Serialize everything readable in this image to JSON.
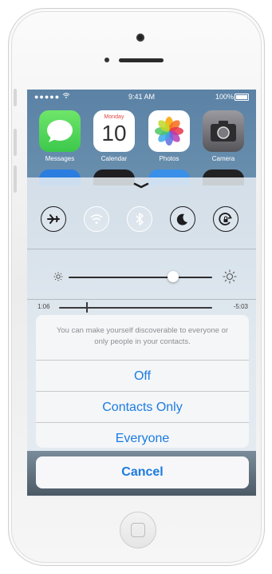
{
  "status_bar": {
    "carrier": "●●●●●",
    "time": "9:41 AM",
    "battery_percent": "100%",
    "battery_level": 1.0
  },
  "home_apps": [
    {
      "label": "Messages",
      "icon": "messages-icon",
      "color": "#4cd964"
    },
    {
      "label": "Calendar",
      "icon": "calendar-icon",
      "color": "#ffffff",
      "day_name": "Monday",
      "day_number": "10"
    },
    {
      "label": "Photos",
      "icon": "photos-icon",
      "color": "#ffffff"
    },
    {
      "label": "Camera",
      "icon": "camera-icon",
      "color": "#6d6d72"
    }
  ],
  "control_center": {
    "toggles": [
      {
        "name": "airplane-mode",
        "icon": "airplane-icon",
        "active": false
      },
      {
        "name": "wifi",
        "icon": "wifi-icon",
        "active": false
      },
      {
        "name": "bluetooth",
        "icon": "bluetooth-icon",
        "active": false
      },
      {
        "name": "do-not-disturb",
        "icon": "moon-icon",
        "active": false
      },
      {
        "name": "rotation-lock",
        "icon": "rotation-lock-icon",
        "active": false
      }
    ],
    "brightness_level": 0.73,
    "music": {
      "elapsed": "1:06",
      "remaining": "-5:03",
      "progress": 0.18
    }
  },
  "action_sheet": {
    "message": "You can make yourself discoverable to everyone or only people in your contacts.",
    "options": [
      "Off",
      "Contacts Only",
      "Everyone"
    ],
    "cancel_label": "Cancel"
  },
  "colors": {
    "accent": "#1c7be0",
    "muted_text": "#8e8e93"
  }
}
